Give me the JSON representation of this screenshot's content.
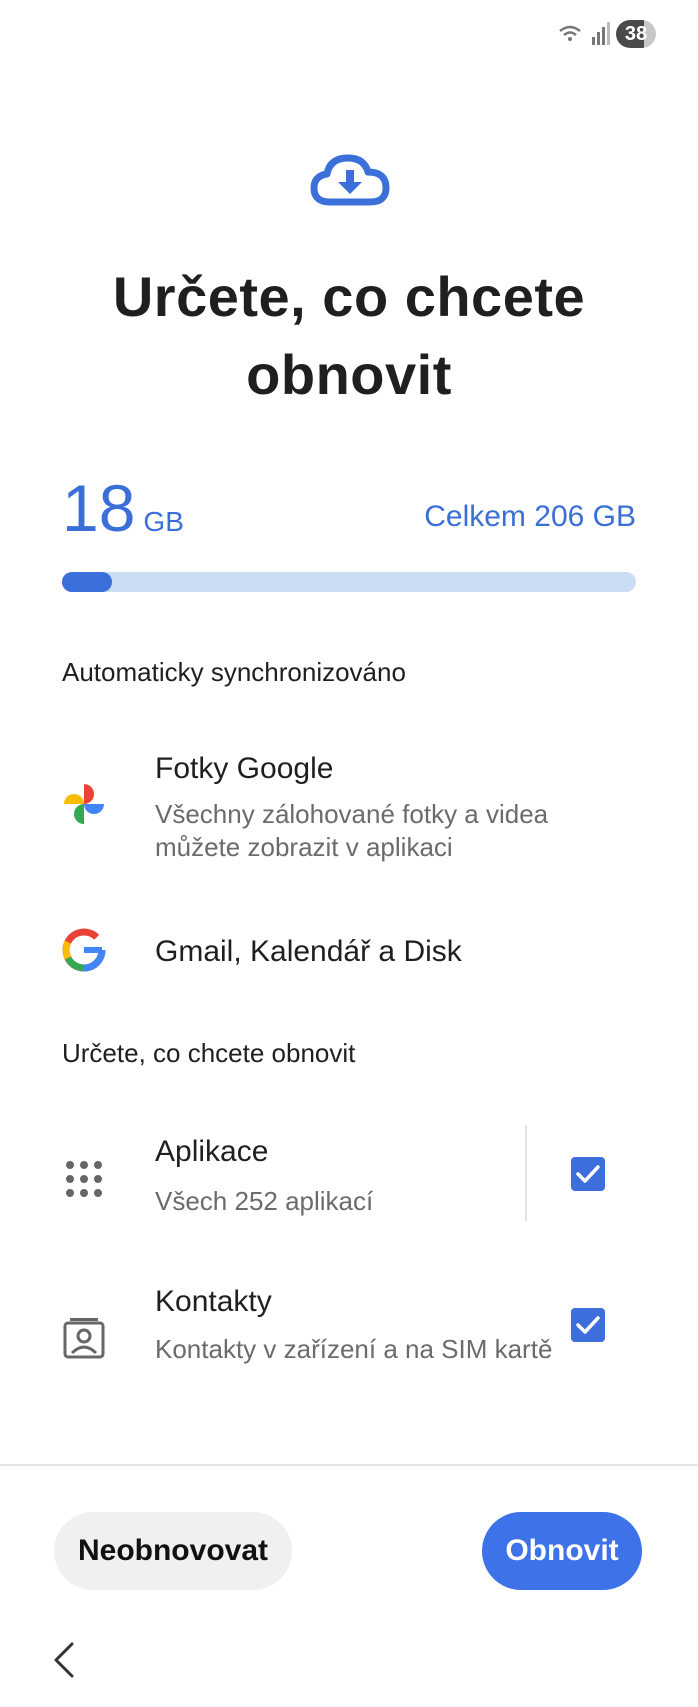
{
  "status_bar": {
    "battery": "38"
  },
  "header": {
    "icon": "cloud-download-icon",
    "title_line1": "Určete, co chcete",
    "title_line2": "obnovit"
  },
  "storage": {
    "used_value": "18",
    "used_unit": "GB",
    "total_text": "Celkem 206 GB",
    "progress_fraction": 0.087
  },
  "auto_sync": {
    "label": "Automaticky synchronizováno",
    "items": [
      {
        "icon": "google-photos-icon",
        "title": "Fotky Google",
        "subtitle": "Všechny zálohované fotky a videa můžete zobrazit v aplikaci"
      },
      {
        "icon": "google-g-icon",
        "title": "Gmail, Kalendář a Disk"
      }
    ]
  },
  "choose": {
    "label": "Určete, co chcete obnovit",
    "items": [
      {
        "icon": "apps-grid-icon",
        "title": "Aplikace",
        "subtitle": "Všech 252 aplikací",
        "checked": true
      },
      {
        "icon": "contacts-icon",
        "title": "Kontakty",
        "subtitle": "Kontakty v zařízení a na SIM kartě",
        "checked": true
      }
    ]
  },
  "buttons": {
    "skip_label": "Neobnovovat",
    "restore_label": "Obnovit"
  },
  "colors": {
    "accent": "#3b6fd9",
    "track": "#cbdcf5"
  }
}
